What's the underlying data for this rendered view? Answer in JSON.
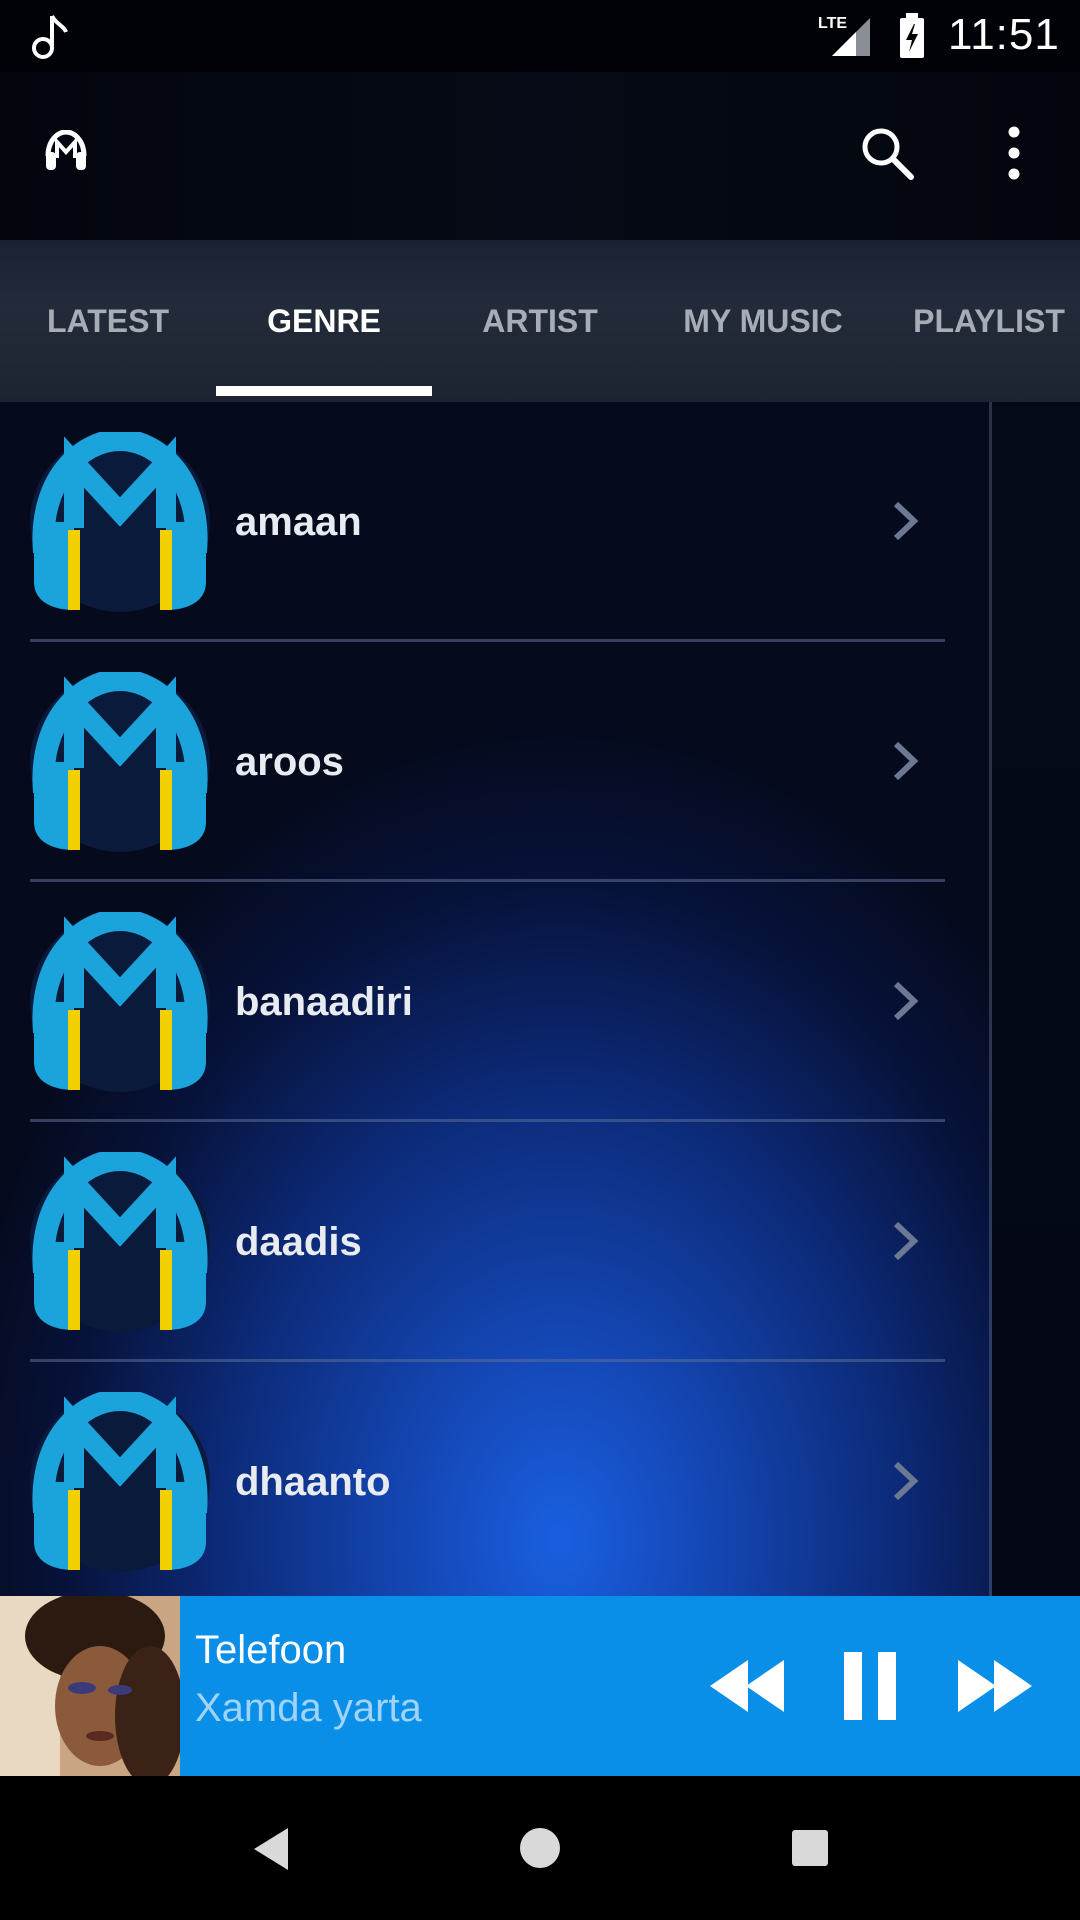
{
  "status_bar": {
    "time": "11:51",
    "network": "LTE",
    "notification_icon": "music-note-icon",
    "battery_icon": "battery-charging-icon"
  },
  "app_bar": {
    "logo_icon": "headphones-m-logo-icon",
    "search_icon": "search-icon",
    "menu_icon": "more-vert-icon"
  },
  "tabs": [
    {
      "label": "LATEST",
      "active": false
    },
    {
      "label": "GENRE",
      "active": true
    },
    {
      "label": "ARTIST",
      "active": false
    },
    {
      "label": "MY MUSIC",
      "active": false
    },
    {
      "label": "PLAYLIST",
      "active": false
    }
  ],
  "genres": [
    {
      "label": "amaan"
    },
    {
      "label": "aroos"
    },
    {
      "label": "banaadiri"
    },
    {
      "label": "daadis"
    },
    {
      "label": "dhaanto"
    }
  ],
  "player": {
    "title": "Telefoon",
    "artist": "Xamda yarta",
    "state": "playing"
  },
  "colors": {
    "player_bg": "#0a8fe8",
    "logo_blue": "#1ba3dc",
    "logo_yellow": "#f2d000",
    "tab_active": "#ffffff",
    "tab_inactive": "#a7adb6"
  }
}
